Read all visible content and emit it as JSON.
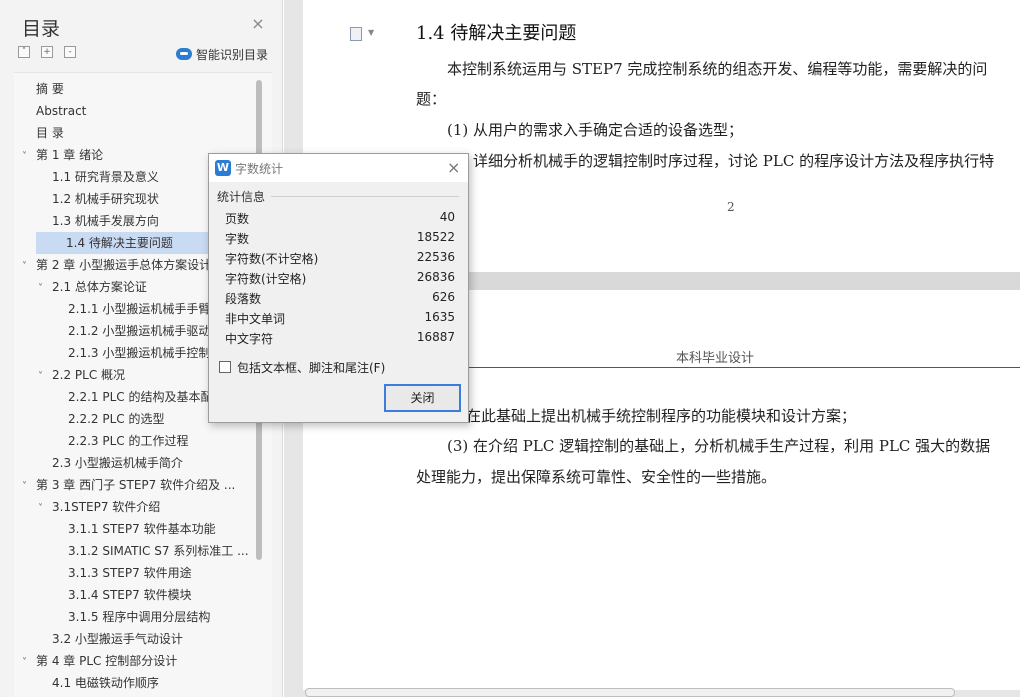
{
  "toc": {
    "title": "目录",
    "smart_label": "智能识别目录",
    "tool_buttons": [
      "˅",
      "+",
      "-"
    ],
    "items": [
      {
        "label": "摘  要",
        "level": 0,
        "chevron": ""
      },
      {
        "label": "Abstract",
        "level": 0,
        "chevron": ""
      },
      {
        "label": "目  录",
        "level": 0,
        "chevron": ""
      },
      {
        "label": "第 1 章  绪论",
        "level": 0,
        "chevron": "˅"
      },
      {
        "label": "1.1  研究背景及意义",
        "level": 1,
        "chevron": ""
      },
      {
        "label": "1.2  机械手研究现状",
        "level": 1,
        "chevron": ""
      },
      {
        "label": "1.3  机械手发展方向",
        "level": 1,
        "chevron": ""
      },
      {
        "label": "1.4  待解决主要问题",
        "level": 1,
        "chevron": "",
        "selected": true
      },
      {
        "label": "第 2 章    小型搬运手总体方案设计",
        "level": 0,
        "chevron": "˅"
      },
      {
        "label": "2.1  总体方案论证",
        "level": 1,
        "chevron": "˅"
      },
      {
        "label": "2.1.1  小型搬运机械手手臂",
        "level": 2,
        "chevron": ""
      },
      {
        "label": "2.1.2  小型搬运机械手驱动",
        "level": 2,
        "chevron": ""
      },
      {
        "label": "2.1.3  小型搬运机械手控制",
        "level": 2,
        "chevron": ""
      },
      {
        "label": "2.2 PLC  概况",
        "level": 1,
        "chevron": "˅"
      },
      {
        "label": "2.2.1 PLC 的结构及基本配置",
        "level": 2,
        "chevron": ""
      },
      {
        "label": "2.2.2 PLC 的选型",
        "level": 2,
        "chevron": ""
      },
      {
        "label": "2.2.3 PLC 的工作过程",
        "level": 2,
        "chevron": ""
      },
      {
        "label": "2.3 小型搬运机械手简介",
        "level": 1,
        "chevron": ""
      },
      {
        "label": "第 3 章    西门子 STEP7 软件介绍及 ...",
        "level": 0,
        "chevron": "˅"
      },
      {
        "label": "3.1STEP7 软件介绍",
        "level": 1,
        "chevron": "˅"
      },
      {
        "label": "3.1.1 STEP7 软件基本功能",
        "level": 2,
        "chevron": ""
      },
      {
        "label": "3.1.2 SIMATIC S7 系列标准工 ...",
        "level": 2,
        "chevron": ""
      },
      {
        "label": "3.1.3 STEP7 软件用途",
        "level": 2,
        "chevron": ""
      },
      {
        "label": "3.1.4 STEP7 软件模块",
        "level": 2,
        "chevron": ""
      },
      {
        "label": "3.1.5  程序中调用分层结构",
        "level": 2,
        "chevron": ""
      },
      {
        "label": "3.2 小型搬运手气动设计",
        "level": 1,
        "chevron": ""
      },
      {
        "label": "第 4 章    PLC 控制部分设计",
        "level": 0,
        "chevron": "˅"
      },
      {
        "label": "4.1  电磁铁动作顺序",
        "level": 1,
        "chevron": ""
      }
    ]
  },
  "document": {
    "heading": "1.4  待解决主要问题",
    "para1_line1": "本控制系统运用与 STEP7 完成控制系统的组态开发、编程等功能，需要解决的问",
    "para1_line2": "题：",
    "item1": "(1)  从用户的需求入手确定合适的设备选型；",
    "item2_partial": "详细分析机械手的逻辑控制时序过程，讨论 PLC 的程序设计方法及程序执行特",
    "page_number": "2",
    "page2_header": "本科毕业设计",
    "item2_cont": "在此基础上提出机械手统控制程序的功能模块和设计方案；",
    "item3_line1": "(3)  在介绍 PLC 逻辑控制的基础上，分析机械手生产过程，利用 PLC 强大的数据",
    "item3_line2": "处理能力，提出保障系统可靠性、安全性的一些措施。"
  },
  "dialog": {
    "logo": "W",
    "title": "字数统计",
    "section": "统计信息",
    "stats": [
      {
        "label": "页数",
        "value": "40"
      },
      {
        "label": "字数",
        "value": "18522"
      },
      {
        "label": "字符数(不计空格)",
        "value": "22536"
      },
      {
        "label": "字符数(计空格)",
        "value": "26836"
      },
      {
        "label": "段落数",
        "value": "626"
      },
      {
        "label": "非中文单词",
        "value": "1635"
      },
      {
        "label": "中文字符",
        "value": "16887"
      }
    ],
    "checkbox_label": "包括文本框、脚注和尾注(F)",
    "checkbox_checked": false,
    "close_button": "关闭"
  }
}
